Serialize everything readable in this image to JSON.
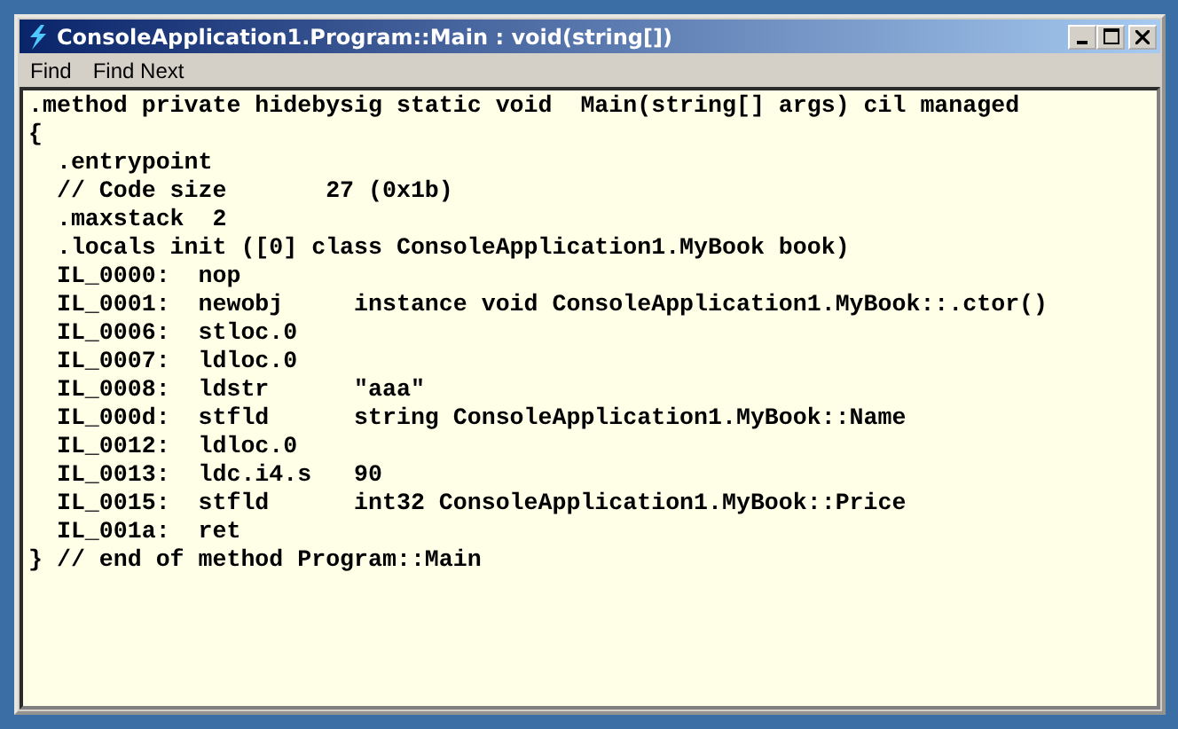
{
  "window": {
    "title": "ConsoleApplication1.Program::Main : void(string[])"
  },
  "menu": [
    "Find",
    "Find Next"
  ],
  "code_lines": [
    ".method private hidebysig static void  Main(string[] args) cil managed",
    "{",
    "  .entrypoint",
    "  // Code size       27 (0x1b)",
    "  .maxstack  2",
    "  .locals init ([0] class ConsoleApplication1.MyBook book)",
    "  IL_0000:  nop",
    "  IL_0001:  newobj     instance void ConsoleApplication1.MyBook::.ctor()",
    "  IL_0006:  stloc.0",
    "  IL_0007:  ldloc.0",
    "  IL_0008:  ldstr      \"aaa\"",
    "  IL_000d:  stfld      string ConsoleApplication1.MyBook::Name",
    "  IL_0012:  ldloc.0",
    "  IL_0013:  ldc.i4.s   90",
    "  IL_0015:  stfld      int32 ConsoleApplication1.MyBook::Price",
    "  IL_001a:  ret",
    "} // end of method Program::Main"
  ]
}
